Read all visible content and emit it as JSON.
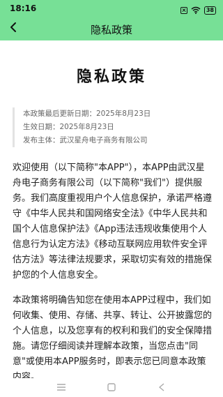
{
  "status_bar": {
    "time": "18:16",
    "battery": "38",
    "icons": [
      "sim-off-icon",
      "wifi-icon",
      "battery-icon"
    ]
  },
  "header": {
    "title": "隐私政策",
    "back_icon": "chevron-left-icon",
    "background_color": "#77e096"
  },
  "document": {
    "title": "隐私政策",
    "meta": [
      "本政策最后更新日期：2025年8月23日",
      "生效日期：2025年8月23日",
      "发布主体：武汉星舟电子商务有限公司"
    ],
    "paragraphs": [
      "欢迎使用（以下简称\"本APP\"），本APP由武汉星舟电子商务有限公司（以下简称\"我们\"）提供服务。我们高度重视用户个人信息保护，承诺严格遵守《中华人民共和国网络安全法》《中华人民共和国个人信息保护法》《App违法违规收集使用个人信息行为认定方法》《移动互联网应用软件安全评估方法》等法律法规要求，采取切实有效的措施保护您的个人信息安全。",
      "本政策将明确告知您在使用本APP过程中，我们如何收集、使用、存储、共享、转让、公开披露您的个人信息，以及您享有的权利和我们的安全保障措施。请您仔细阅读并理解本政策，当您点击\"同意\"或使用本APP服务时，即表示您已同意本政策内容。"
    ]
  },
  "nav_bar": {
    "items": [
      "menu-icon",
      "home-square-icon",
      "back-triangle-icon"
    ]
  }
}
